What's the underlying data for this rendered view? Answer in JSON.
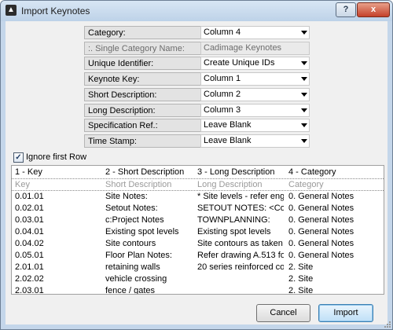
{
  "window": {
    "title": "Import Keynotes",
    "help_label": "?",
    "close_label": "x"
  },
  "form": {
    "rows": [
      {
        "label": "Category:",
        "value": "Column 4",
        "disabled": false,
        "dropdown": true
      },
      {
        "label": ":. Single Category Name:",
        "value": "Cadimage Keynotes",
        "disabled": true,
        "dropdown": false
      },
      {
        "label": "Unique Identifier:",
        "value": "Create Unique IDs",
        "disabled": false,
        "dropdown": true
      },
      {
        "label": "Keynote Key:",
        "value": "Column 1",
        "disabled": false,
        "dropdown": true
      },
      {
        "label": "Short Description:",
        "value": "Column 2",
        "disabled": false,
        "dropdown": true
      },
      {
        "label": "Long Description:",
        "value": "Column 3",
        "disabled": false,
        "dropdown": true
      },
      {
        "label": "Specification Ref.:",
        "value": "Leave Blank",
        "disabled": false,
        "dropdown": true
      },
      {
        "label": "Time Stamp:",
        "value": "Leave Blank",
        "disabled": false,
        "dropdown": true
      }
    ]
  },
  "ignore_first_row": {
    "checked": true,
    "label": "Ignore first Row"
  },
  "table": {
    "headers": [
      "1 - Key",
      "2 - Short Description",
      "3 - Long Description",
      "4 - Category"
    ],
    "subheaders": [
      "Key",
      "Short Description",
      "Long Description",
      "Category"
    ],
    "rows": [
      [
        "0.01.01",
        "Site Notes:",
        "* Site levels - refer engin...",
        "0. General Notes"
      ],
      [
        "0.02.01",
        "Setout Notes:",
        "SETOUT NOTES: <Cont...",
        "0. General Notes"
      ],
      [
        "0.03.01",
        "c:Project Notes",
        "TOWNPLANNING:",
        "0. General Notes"
      ],
      [
        "0.04.01",
        "Existing spot levels",
        "Existing spot levels",
        "0. General Notes"
      ],
      [
        "0.04.02",
        "Site contours",
        "Site contours as taken fr...",
        "0. General Notes"
      ],
      [
        "0.05.01",
        "Floor Plan Notes:",
        "Refer drawing A.513 for ...",
        "0. General Notes"
      ],
      [
        "2.01.01",
        "retaining walls",
        "20 series reinforced conc...",
        "2. Site"
      ],
      [
        "2.02.02",
        "vehicle crossing",
        "",
        "2. Site"
      ],
      [
        "2.03.01",
        "fence / gates",
        "",
        "2. Site"
      ]
    ]
  },
  "buttons": {
    "cancel": "Cancel",
    "import": "Import"
  }
}
